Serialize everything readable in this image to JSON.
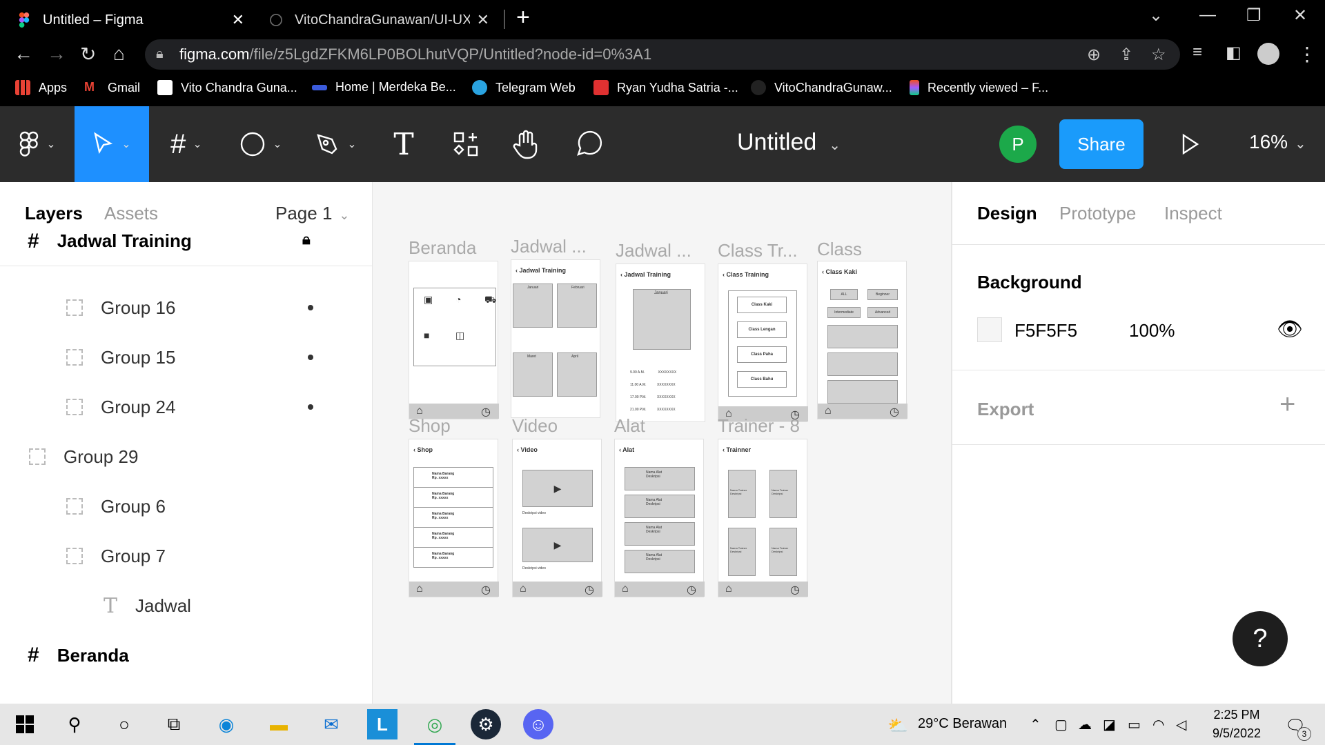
{
  "browser": {
    "tabs": [
      {
        "title": "Untitled – Figma",
        "active": true
      },
      {
        "title": "VitoChandraGunawan/UI-UX_Vito",
        "active": false
      }
    ],
    "url_domain": "figma.com",
    "url_path": "/file/z5LgdZFKM6LP0BOLhutVQP/Untitled?node-id=0%3A1",
    "bookmarks": [
      {
        "label": "Apps",
        "color": "#e94235"
      },
      {
        "label": "Gmail",
        "color": "#ea4335"
      },
      {
        "label": "Vito Chandra Guna...",
        "color": "#ffffff"
      },
      {
        "label": "Home | Merdeka Be...",
        "color": "#3b5bdb"
      },
      {
        "label": "Telegram Web",
        "color": "#2aa3e0"
      },
      {
        "label": "Ryan Yudha Satria -...",
        "color": "#e03131"
      },
      {
        "label": "VitoChandraGunaw...",
        "color": "#222222"
      },
      {
        "label": "Recently viewed – F...",
        "color": "#f24e1e"
      }
    ]
  },
  "figma": {
    "title": "Untitled",
    "avatar_letter": "P",
    "share_label": "Share",
    "zoom": "16%",
    "accent": "#1e90ff",
    "left_panel": {
      "tab_layers": "Layers",
      "tab_assets": "Assets",
      "page": "Page 1",
      "layers": [
        {
          "name": "Jadwal Training",
          "kind": "frame",
          "indent": 0,
          "bold": true,
          "locked": true
        },
        {
          "name": "Group 16",
          "kind": "group",
          "indent": 1,
          "dot": true
        },
        {
          "name": "Group 15",
          "kind": "group",
          "indent": 1,
          "dot": true
        },
        {
          "name": "Group 24",
          "kind": "group",
          "indent": 1,
          "dot": true
        },
        {
          "name": "Group 29",
          "kind": "group",
          "indent": 0
        },
        {
          "name": "Group 6",
          "kind": "group",
          "indent": 1
        },
        {
          "name": "Group 7",
          "kind": "group",
          "indent": 1
        },
        {
          "name": "Jadwal",
          "kind": "text",
          "indent": 2
        },
        {
          "name": "Beranda",
          "kind": "frame",
          "indent": 0,
          "bold": true
        }
      ]
    },
    "canvas": {
      "frames": [
        {
          "label": "Beranda",
          "header": ""
        },
        {
          "label": "Jadwal ...",
          "header": "Jadwal Training"
        },
        {
          "label": "Jadwal ...",
          "header": "Jadwal Training"
        },
        {
          "label": "Class Tr...",
          "header": "Class Training"
        },
        {
          "label": "Class",
          "header": "Class Kaki"
        },
        {
          "label": "Shop",
          "header": "Shop"
        },
        {
          "label": "Video",
          "header": "Video"
        },
        {
          "label": "Alat",
          "header": "Alat"
        },
        {
          "label": "Trainer - 8",
          "header": "Trainner"
        }
      ],
      "class_buttons": [
        "Class Kaki",
        "Class Lengan",
        "Class Paha",
        "Class Bahu"
      ],
      "level_buttons": [
        "ALL",
        "Beginner",
        "Intermediate",
        "Advanced"
      ],
      "months": [
        "Januari",
        "Februari",
        "Maret",
        "April"
      ],
      "schedule_times": [
        "9.00 A.M.",
        "11.00 A.M.",
        "17.00 P.M.",
        "21.00 P.M."
      ],
      "schedule_value": "XXXXXXXX",
      "shop_item": "Nama Barang",
      "shop_price": "Rp. xxxxx",
      "video_desc": "Deskripsi video",
      "alat_item": "Nama Alat",
      "alat_desc": "Deskripsi",
      "trainer_item": "Nama Trainer",
      "trainer_desc": "Deskripsi"
    },
    "right_panel": {
      "tab_design": "Design",
      "tab_prototype": "Prototype",
      "tab_inspect": "Inspect",
      "background_title": "Background",
      "background_hex": "F5F5F5",
      "background_color": "#F5F5F5",
      "background_opacity": "100%",
      "export_title": "Export"
    },
    "help_label": "?"
  },
  "taskbar": {
    "weather": "29°C  Berawan",
    "time": "2:25 PM",
    "date": "9/5/2022",
    "notif_count": "3"
  }
}
